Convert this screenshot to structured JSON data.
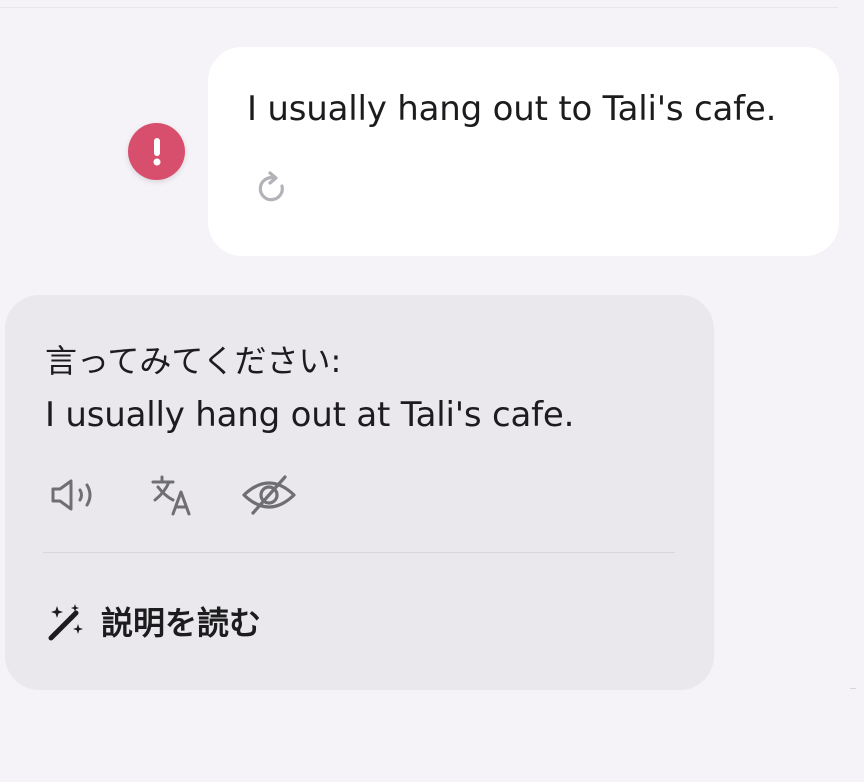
{
  "user_message": {
    "text": "I usually hang out to Tali's cafe.",
    "retry_icon": "retry-icon",
    "error_icon": "exclamation-icon",
    "error_color": "#d84f6e"
  },
  "suggestion": {
    "prompt_label": "言ってみてください:",
    "corrected_text": "I usually hang out at Tali's cafe.",
    "actions": [
      {
        "icon": "speaker-icon"
      },
      {
        "icon": "translate-icon"
      },
      {
        "icon": "eye-slash-icon"
      }
    ],
    "explain_icon": "magic-wand-icon",
    "explain_label": "説明を読む"
  },
  "colors": {
    "background": "#f5f3f7",
    "user_bubble": "#ffffff",
    "suggestion_card": "#eae8ec",
    "text": "#1c1c1e",
    "icon_gray": "#6e6e73"
  }
}
